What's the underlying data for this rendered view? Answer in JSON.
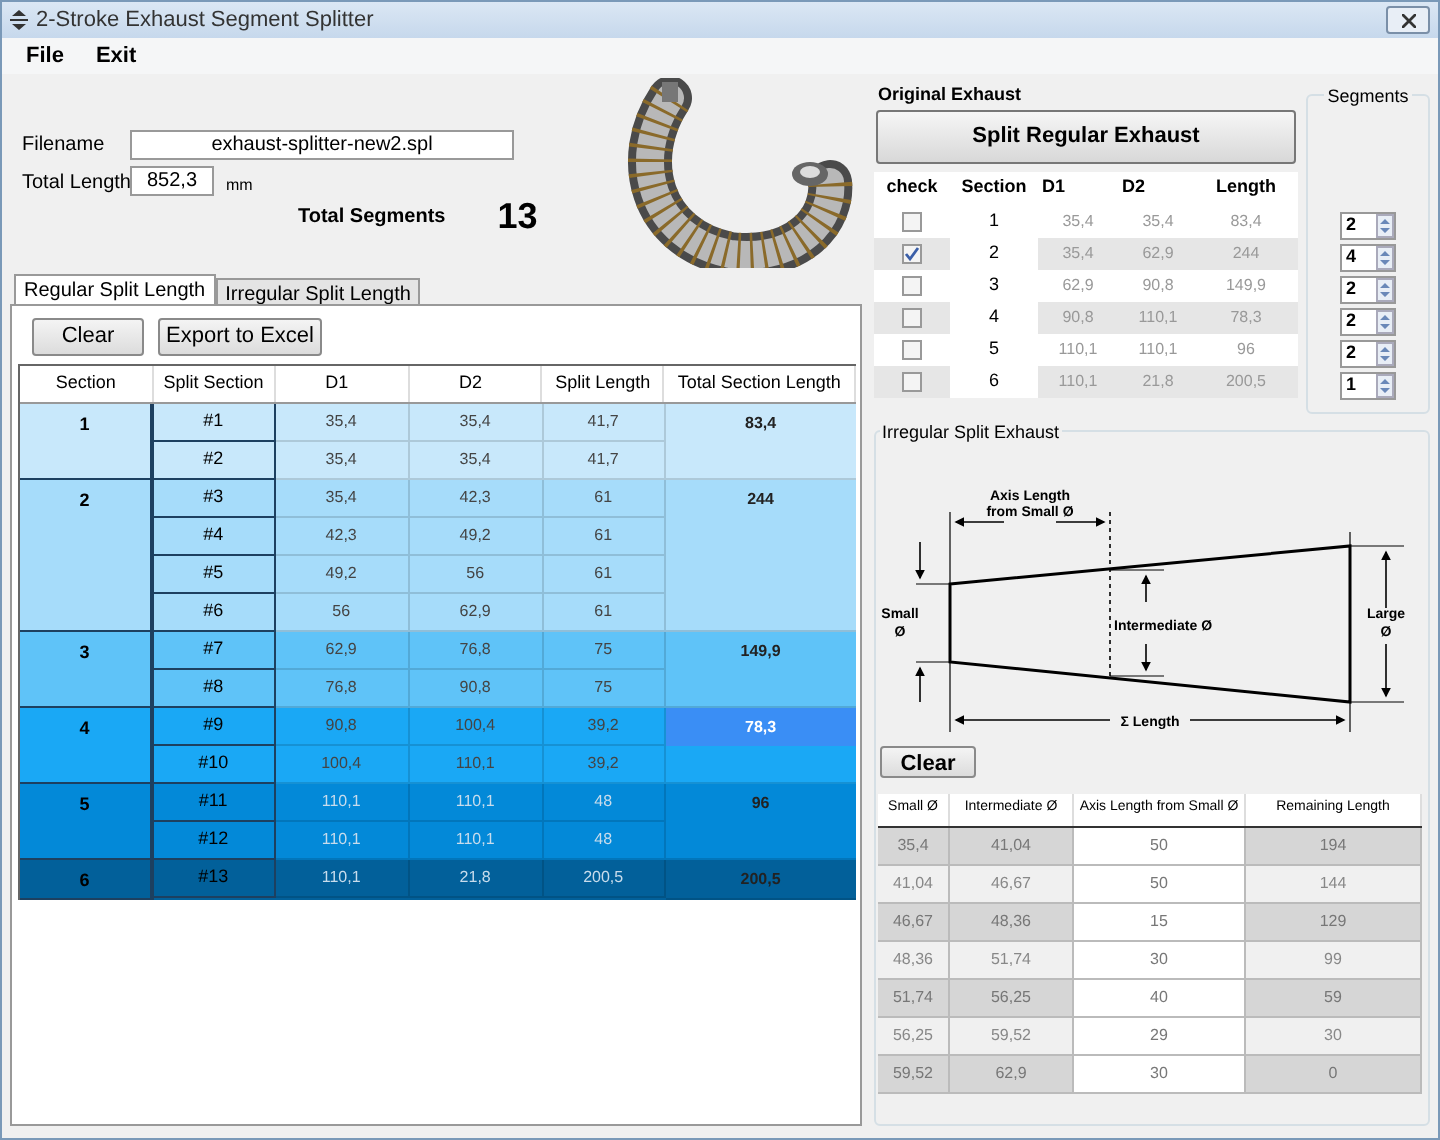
{
  "window": {
    "title": "2-Stroke Exhaust Segment Splitter"
  },
  "menu": [
    "File",
    "Exit"
  ],
  "form": {
    "filename_label": "Filename",
    "filename": "exhaust-splitter-new2.spl",
    "total_length_label": "Total Length",
    "total_length": "852,3",
    "unit": "mm",
    "total_segments_label": "Total Segments",
    "total_segments": "13"
  },
  "tabs": [
    {
      "label": "Regular Split Length",
      "selected": true
    },
    {
      "label": "Irregular Split Length",
      "selected": false
    }
  ],
  "regular": {
    "buttons": [
      "Clear",
      "Export to Excel"
    ],
    "columns": [
      "Section",
      "Split Section",
      "D1",
      "D2",
      "Split Length",
      "Total Section Length"
    ],
    "sections": [
      {
        "section": "1",
        "color": "#c8e8fb",
        "total": "83,4",
        "selected": false,
        "rows": [
          {
            "split": "#1",
            "d1": "35,4",
            "d2": "35,4",
            "length": "41,7"
          },
          {
            "split": "#2",
            "d1": "35,4",
            "d2": "35,4",
            "length": "41,7"
          }
        ]
      },
      {
        "section": "2",
        "color": "#a6dcfa",
        "total": "244",
        "selected": false,
        "rows": [
          {
            "split": "#3",
            "d1": "35,4",
            "d2": "42,3",
            "length": "61"
          },
          {
            "split": "#4",
            "d1": "42,3",
            "d2": "49,2",
            "length": "61"
          },
          {
            "split": "#5",
            "d1": "49,2",
            "d2": "56",
            "length": "61"
          },
          {
            "split": "#6",
            "d1": "56",
            "d2": "62,9",
            "length": "61"
          }
        ]
      },
      {
        "section": "3",
        "color": "#5fc3f8",
        "total": "149,9",
        "selected": false,
        "rows": [
          {
            "split": "#7",
            "d1": "62,9",
            "d2": "76,8",
            "length": "75"
          },
          {
            "split": "#8",
            "d1": "76,8",
            "d2": "90,8",
            "length": "75"
          }
        ]
      },
      {
        "section": "4",
        "color": "#1aa8f5",
        "total": "78,3",
        "selected": true,
        "rows": [
          {
            "split": "#9",
            "d1": "90,8",
            "d2": "100,4",
            "length": "39,2"
          },
          {
            "split": "#10",
            "d1": "100,4",
            "d2": "110,1",
            "length": "39,2"
          }
        ]
      },
      {
        "section": "5",
        "color": "#0389d8",
        "total": "96",
        "selected": false,
        "rows": [
          {
            "split": "#11",
            "d1": "110,1",
            "d2": "110,1",
            "length": "48"
          },
          {
            "split": "#12",
            "d1": "110,1",
            "d2": "110,1",
            "length": "48"
          }
        ]
      },
      {
        "section": "6",
        "color": "#02609a",
        "total": "200,5",
        "selected": false,
        "rows": [
          {
            "split": "#13",
            "d1": "110,1",
            "d2": "21,8",
            "length": "200,5"
          }
        ]
      }
    ]
  },
  "original": {
    "title": "Original Exhaust",
    "button": "Split Regular Exhaust",
    "columns": [
      "check",
      "Section",
      "D1",
      "D2",
      "Length"
    ],
    "rows": [
      {
        "checked": false,
        "section": "1",
        "d1": "35,4",
        "d2": "35,4",
        "length": "83,4"
      },
      {
        "checked": true,
        "section": "2",
        "d1": "35,4",
        "d2": "62,9",
        "length": "244"
      },
      {
        "checked": false,
        "section": "3",
        "d1": "62,9",
        "d2": "90,8",
        "length": "149,9"
      },
      {
        "checked": false,
        "section": "4",
        "d1": "90,8",
        "d2": "110,1",
        "length": "78,3"
      },
      {
        "checked": false,
        "section": "5",
        "d1": "110,1",
        "d2": "110,1",
        "length": "96"
      },
      {
        "checked": false,
        "section": "6",
        "d1": "110,1",
        "d2": "21,8",
        "length": "200,5"
      }
    ]
  },
  "segments": {
    "title": "Segments",
    "values": [
      "2",
      "4",
      "2",
      "2",
      "2",
      "1"
    ]
  },
  "irregular": {
    "title": "Irregular Split Exhaust",
    "diagram": {
      "axis": [
        "Axis Length",
        "from Small Ø"
      ],
      "small": [
        "Small",
        "Ø"
      ],
      "intermediate": "Intermediate Ø",
      "large": [
        "Large",
        "Ø"
      ],
      "length": "Σ Length"
    },
    "button": "Clear",
    "columns": [
      "Small Ø",
      "Intermediate Ø",
      "Axis Length from Small Ø",
      "Remaining Length"
    ],
    "rows": [
      [
        "35,4",
        "41,04",
        "50",
        "194"
      ],
      [
        "41,04",
        "46,67",
        "50",
        "144"
      ],
      [
        "46,67",
        "48,36",
        "15",
        "129"
      ],
      [
        "48,36",
        "51,74",
        "30",
        "99"
      ],
      [
        "51,74",
        "56,25",
        "40",
        "59"
      ],
      [
        "56,25",
        "59,52",
        "29",
        "30"
      ],
      [
        "59,52",
        "62,9",
        "30",
        "0"
      ]
    ]
  }
}
